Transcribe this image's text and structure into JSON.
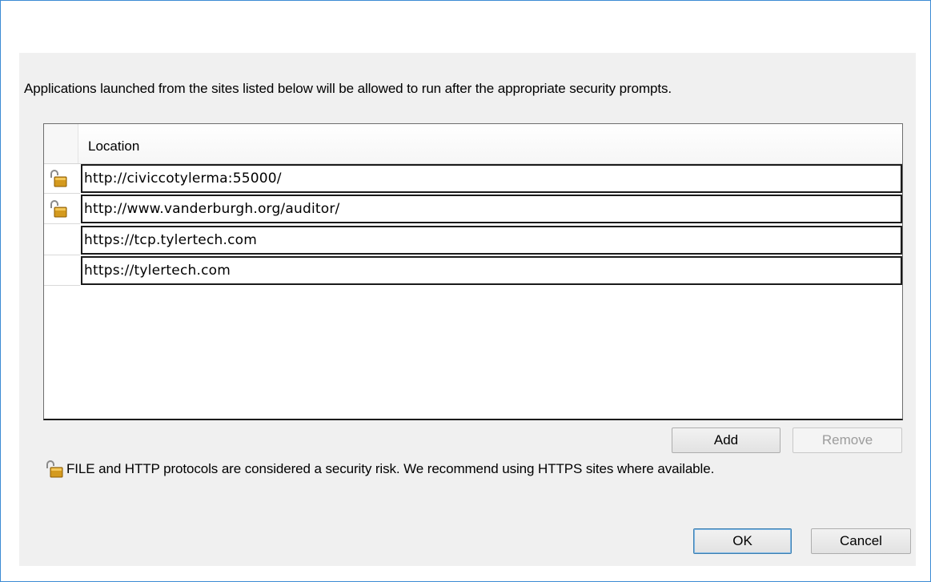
{
  "dialog": {
    "intro_text": "Applications launched from the sites listed below will be allowed to run after the appropriate security prompts.",
    "table": {
      "column_header": "Location",
      "rows": [
        {
          "url": "http://civiccotylerma:55000/",
          "icon": "unlocked-padlock-icon"
        },
        {
          "url": "http://www.vanderburgh.org/auditor/",
          "icon": "unlocked-padlock-icon"
        },
        {
          "url": "https://tcp.tylertech.com",
          "icon": ""
        },
        {
          "url": "https://tylertech.com",
          "icon": ""
        }
      ]
    },
    "buttons": {
      "add": "Add",
      "remove": "Remove",
      "ok": "OK",
      "cancel": "Cancel"
    },
    "warning_text": "FILE and HTTP protocols are considered a security risk.  We recommend using HTTPS sites where available.",
    "colors": {
      "window_border": "#3c8bd4",
      "dialog_bg": "#f0f0f0",
      "lock_gold": "#d49a1e"
    }
  }
}
